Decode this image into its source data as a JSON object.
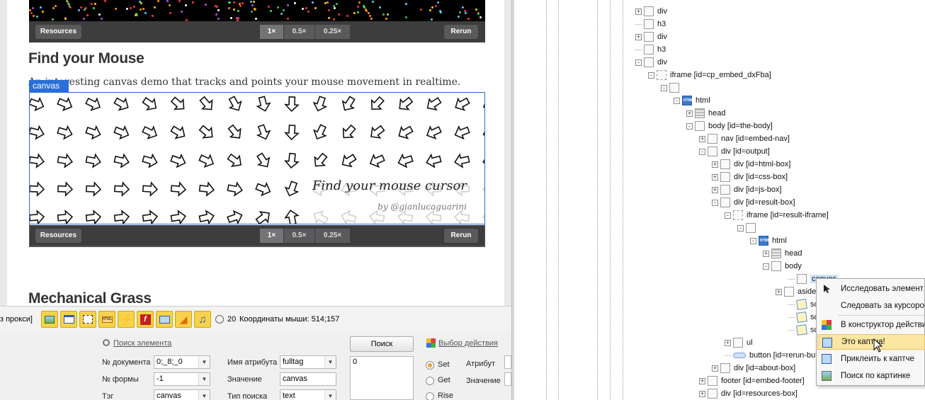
{
  "browser": {
    "pen_top": {
      "resources_label": "Resources",
      "zoom_options": [
        "1×",
        "0.5×",
        "0.25×"
      ],
      "rerun_label": "Rerun"
    },
    "section1_title": "Find your Mouse",
    "section1_desc": "An interesting canvas demo that tracks and points your mouse movement in realtime.",
    "canvas_tag": "canvas",
    "demo": {
      "caption": "Find your mouse cursor",
      "credit": "by @gianlucaguarini"
    },
    "pen_bottom": {
      "resources_label": "Resources",
      "zoom_options": [
        "1×",
        "0.5×",
        "0.25×"
      ],
      "rerun_label": "Rerun"
    },
    "section2_title": "Mechanical Grass"
  },
  "toolbar": {
    "proxy_text": "з прокси]",
    "timer_value": "20",
    "mouse_coords": "Координаты мыши: 514;157",
    "buttons": [
      "image-icon",
      "window-icon",
      "frame-icon",
      "html-icon",
      "lightning-icon",
      "flash-icon",
      "screen-icon",
      "sound-icon",
      "music-icon"
    ]
  },
  "form": {
    "find_element_link": "Поиск элемента",
    "doc_num_label": "№ документа",
    "doc_num_value": "0;_8;_0",
    "form_num_label": "№ формы",
    "form_num_value": "-1",
    "tag_label": "Тэг",
    "tag_value": "canvas",
    "attr_name_label": "Имя атрибута",
    "attr_name_value": "fulltag",
    "value_label": "Значение",
    "value_value": "canvas",
    "search_type_label": "Тип поиска",
    "search_type_value": "text",
    "search_button": "Поиск",
    "result_value": "0",
    "action_link": "Выбор действия",
    "radio_set": "Set",
    "radio_get": "Get",
    "radio_rise": "Rise",
    "attr_label": "Атрибут",
    "value2_label": "Значение"
  },
  "tree": {
    "nodes": [
      {
        "label": "div",
        "icon": "box"
      },
      {
        "label": "h3",
        "icon": "box"
      },
      {
        "label": "div",
        "icon": "box"
      },
      {
        "label": "h3",
        "icon": "box"
      },
      {
        "label": "div",
        "icon": "box"
      },
      {
        "label": "iframe [id=cp_embed_dxFba]",
        "icon": "frame"
      },
      {
        "label": "",
        "icon": "box"
      },
      {
        "label": "html",
        "icon": "html"
      },
      {
        "label": "head",
        "icon": "head"
      },
      {
        "label": "body [id=the-body]",
        "icon": "box"
      },
      {
        "label": "nav [id=embed-nav]",
        "icon": "box"
      },
      {
        "label": "div [id=output]",
        "icon": "box"
      },
      {
        "label": "div [id=html-box]",
        "icon": "box"
      },
      {
        "label": "div [id=css-box]",
        "icon": "box"
      },
      {
        "label": "div [id=js-box]",
        "icon": "box"
      },
      {
        "label": "div [id=result-box]",
        "icon": "box"
      },
      {
        "label": "iframe [id=result-iframe]",
        "icon": "frame"
      },
      {
        "label": "",
        "icon": "box"
      },
      {
        "label": "html",
        "icon": "html"
      },
      {
        "label": "head",
        "icon": "head"
      },
      {
        "label": "body",
        "icon": "box"
      },
      {
        "label": "canvas",
        "icon": "box"
      },
      {
        "label": "aside",
        "icon": "box"
      },
      {
        "label": "script",
        "icon": "script"
      },
      {
        "label": "script",
        "icon": "script"
      },
      {
        "label": "script",
        "icon": "script"
      },
      {
        "label": "ul",
        "icon": "box"
      },
      {
        "label": "button [id=rerun-button]",
        "icon": "btn"
      },
      {
        "label": "div [id=about-box]",
        "icon": "box"
      },
      {
        "label": "footer [id=embed-footer]",
        "icon": "box"
      },
      {
        "label": "div [id=resources-box]",
        "icon": "box"
      }
    ]
  },
  "context_menu": {
    "items": [
      {
        "label": "Исследовать элемент",
        "icon": "cursor-icon"
      },
      {
        "label": "Следовать за курсором",
        "icon": "none"
      },
      {
        "label": "В конструктор действий",
        "icon": "grid-icon"
      },
      {
        "label": "Это каптча!",
        "icon": "captcha-icon"
      },
      {
        "label": "Приклеить к каптче",
        "icon": "captcha-attach-icon"
      },
      {
        "label": "Поиск по картинке",
        "icon": "image-search-icon"
      }
    ]
  }
}
